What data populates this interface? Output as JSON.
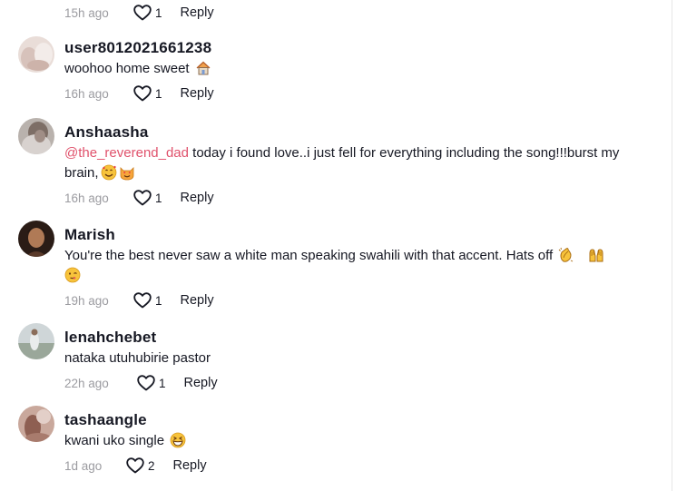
{
  "top_row": {
    "time": "15h ago",
    "likes": "1",
    "reply_label": "Reply"
  },
  "comments": [
    {
      "username": "user8012021661238",
      "text": "woohoo home sweet",
      "emoji": [
        "house-emoji"
      ],
      "time": "16h ago",
      "likes": "1",
      "reply_label": "Reply"
    },
    {
      "username": "Anshaasha",
      "mention": "@the_reverend_dad",
      "text": " today i found love..i just fell for everything including the song!!!burst my brain,",
      "emoji": [
        "smiling-face-with-hearts-emoji",
        "heart-eyes-cat-emoji"
      ],
      "time": "16h ago",
      "likes": "1",
      "reply_label": "Reply"
    },
    {
      "username": "Marish",
      "text": "You're the best never saw a white man speaking swahili with that accent. Hats off",
      "emoji": [
        "clapping-hands-emoji",
        "raising-hands-emoji",
        "winking-face-emoji"
      ],
      "time": "19h ago",
      "likes": "1",
      "reply_label": "Reply"
    },
    {
      "username": "lenahchebet",
      "text": "nataka utuhubirie pastor",
      "emoji": [],
      "time": "22h ago",
      "likes": "1",
      "reply_label": "Reply"
    },
    {
      "username": "tashaangle",
      "text": "kwani uko single",
      "emoji": [
        "grinning-squinting-face-emoji"
      ],
      "time": "1d ago",
      "likes": "2",
      "reply_label": "Reply"
    }
  ],
  "colors": {
    "text": "#161823",
    "muted": "#9b9ba0",
    "mention": "#e0526c",
    "emoji_yellow": "#f7c33b"
  }
}
